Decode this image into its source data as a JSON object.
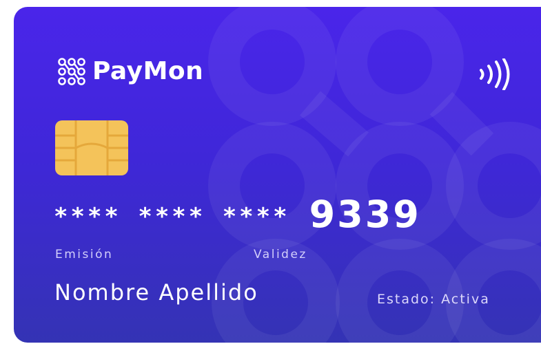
{
  "card": {
    "brand_name": "PayMon",
    "number_masked": "**** **** ****",
    "number_last4": "9339",
    "issue_label": "Emisión",
    "validity_label": "Validez",
    "holder_name": "Nombre Apellido",
    "status_text": "Estado: Activa"
  },
  "icons": {
    "logo": "paymon-logo-icon",
    "contactless": "contactless-icon",
    "chip": "chip-icon"
  },
  "colors": {
    "card_top": "#4a25ea",
    "card_bottom": "#3433b4",
    "chip": "#f4c35a",
    "text": "#ffffff"
  }
}
